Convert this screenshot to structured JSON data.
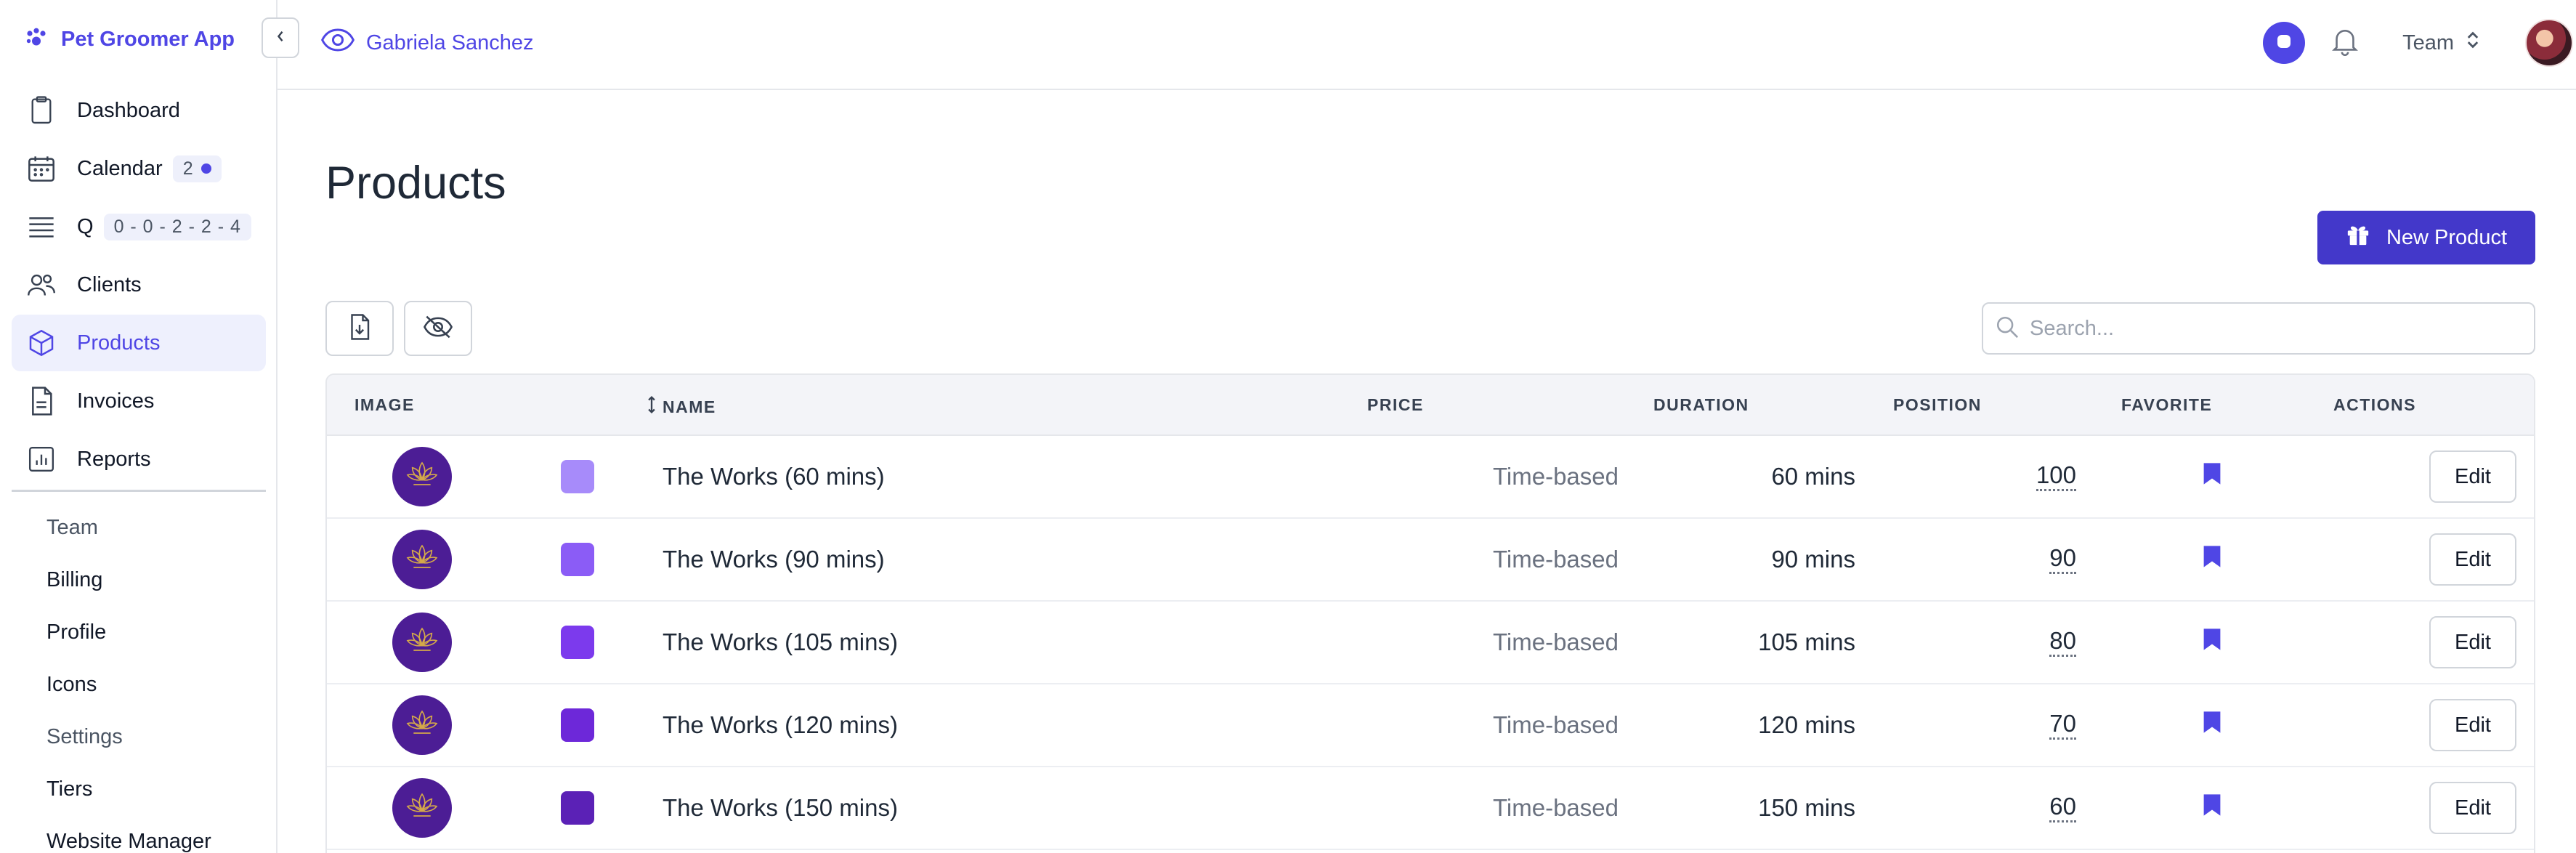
{
  "app": {
    "name": "Pet Groomer App"
  },
  "sidebar": {
    "items": [
      {
        "label": "Dashboard",
        "icon": "clipboard-icon"
      },
      {
        "label": "Calendar",
        "icon": "calendar-icon",
        "badge": "2"
      },
      {
        "label": "Q",
        "icon": "queue-icon",
        "badge": "0 - 0 - 2 - 2 - 4"
      },
      {
        "label": "Clients",
        "icon": "users-icon"
      },
      {
        "label": "Products",
        "icon": "cube-icon",
        "active": true
      },
      {
        "label": "Invoices",
        "icon": "document-icon"
      },
      {
        "label": "Reports",
        "icon": "chart-icon"
      }
    ],
    "sub_items": [
      {
        "label": "Team"
      },
      {
        "label": "Billing"
      },
      {
        "label": "Profile"
      },
      {
        "label": "Icons"
      },
      {
        "label": "Settings"
      },
      {
        "label": "Tiers"
      },
      {
        "label": "Website Manager"
      }
    ]
  },
  "topbar": {
    "viewer_name": "Gabriela Sanchez",
    "team_label": "Team"
  },
  "page": {
    "title": "Products",
    "new_button": "New Product",
    "search_placeholder": "Search..."
  },
  "table": {
    "headers": {
      "image": "IMAGE",
      "name": "NAME",
      "price": "PRICE",
      "duration": "DURATION",
      "position": "POSITION",
      "favorite": "FAVORITE",
      "actions": "ACTIONS"
    },
    "rows": [
      {
        "name": "The Works (60 mins)",
        "price": "Time-based",
        "duration": "60 mins",
        "position": "100",
        "color": "#a78bfa",
        "action": "Edit"
      },
      {
        "name": "The Works (90 mins)",
        "price": "Time-based",
        "duration": "90 mins",
        "position": "90",
        "color": "#8b5cf6",
        "action": "Edit"
      },
      {
        "name": "The Works (105 mins)",
        "price": "Time-based",
        "duration": "105 mins",
        "position": "80",
        "color": "#7c3aed",
        "action": "Edit"
      },
      {
        "name": "The Works (120 mins)",
        "price": "Time-based",
        "duration": "120 mins",
        "position": "70",
        "color": "#6d28d9",
        "action": "Edit"
      },
      {
        "name": "The Works (150 mins)",
        "price": "Time-based",
        "duration": "150 mins",
        "position": "60",
        "color": "#5b21b6",
        "action": "Edit"
      }
    ]
  },
  "colors": {
    "accent": "#4f46e5",
    "button": "#4338ca"
  }
}
